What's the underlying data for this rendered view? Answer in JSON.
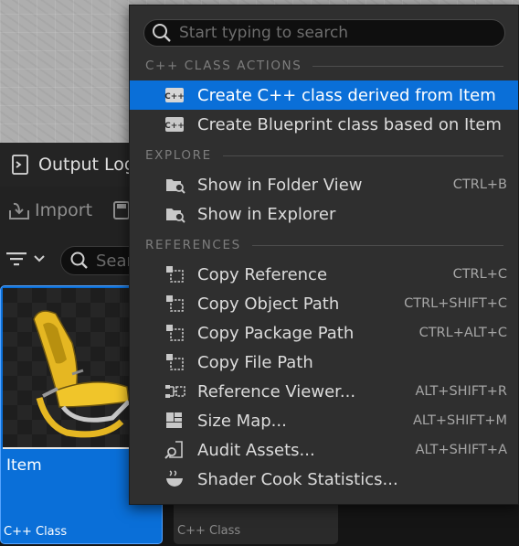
{
  "background": {
    "output_tab_label": "Output Log",
    "import_label": "Import",
    "search_placeholder": "Search",
    "assets": [
      {
        "name": "Item",
        "type": "C++ Class",
        "selected": true
      },
      {
        "name": "",
        "type": "C++ Class",
        "selected": false
      }
    ]
  },
  "menu": {
    "search_placeholder": "Start typing to search",
    "sections": [
      {
        "header": "C++ CLASS ACTIONS",
        "items": [
          {
            "label": "Create C++ class derived from Item",
            "shortcut": "",
            "icon": "cpp-class-icon",
            "highlighted": true
          },
          {
            "label": "Create Blueprint class based on Item",
            "shortcut": "",
            "icon": "cpp-class-icon",
            "highlighted": false
          }
        ]
      },
      {
        "header": "EXPLORE",
        "items": [
          {
            "label": "Show in Folder View",
            "shortcut": "CTRL+B",
            "icon": "folder-search-icon"
          },
          {
            "label": "Show in Explorer",
            "shortcut": "",
            "icon": "folder-search-icon"
          }
        ]
      },
      {
        "header": "REFERENCES",
        "items": [
          {
            "label": "Copy Reference",
            "shortcut": "CTRL+C",
            "icon": "copy-icon"
          },
          {
            "label": "Copy Object Path",
            "shortcut": "CTRL+SHIFT+C",
            "icon": "copy-icon"
          },
          {
            "label": "Copy Package Path",
            "shortcut": "CTRL+ALT+C",
            "icon": "copy-icon"
          },
          {
            "label": "Copy File Path",
            "shortcut": "",
            "icon": "copy-icon"
          },
          {
            "label": "Reference Viewer...",
            "shortcut": "ALT+SHIFT+R",
            "icon": "reference-viewer-icon"
          },
          {
            "label": "Size Map...",
            "shortcut": "ALT+SHIFT+M",
            "icon": "size-map-icon"
          },
          {
            "label": "Audit Assets...",
            "shortcut": "ALT+SHIFT+A",
            "icon": "audit-icon"
          },
          {
            "label": "Shader Cook Statistics...",
            "shortcut": "",
            "icon": "shader-stats-icon"
          }
        ]
      }
    ]
  },
  "colors": {
    "highlight": "#0a6fd8",
    "menu_bg": "#2f2f2f",
    "selected_tile": "#0a6fd8"
  }
}
